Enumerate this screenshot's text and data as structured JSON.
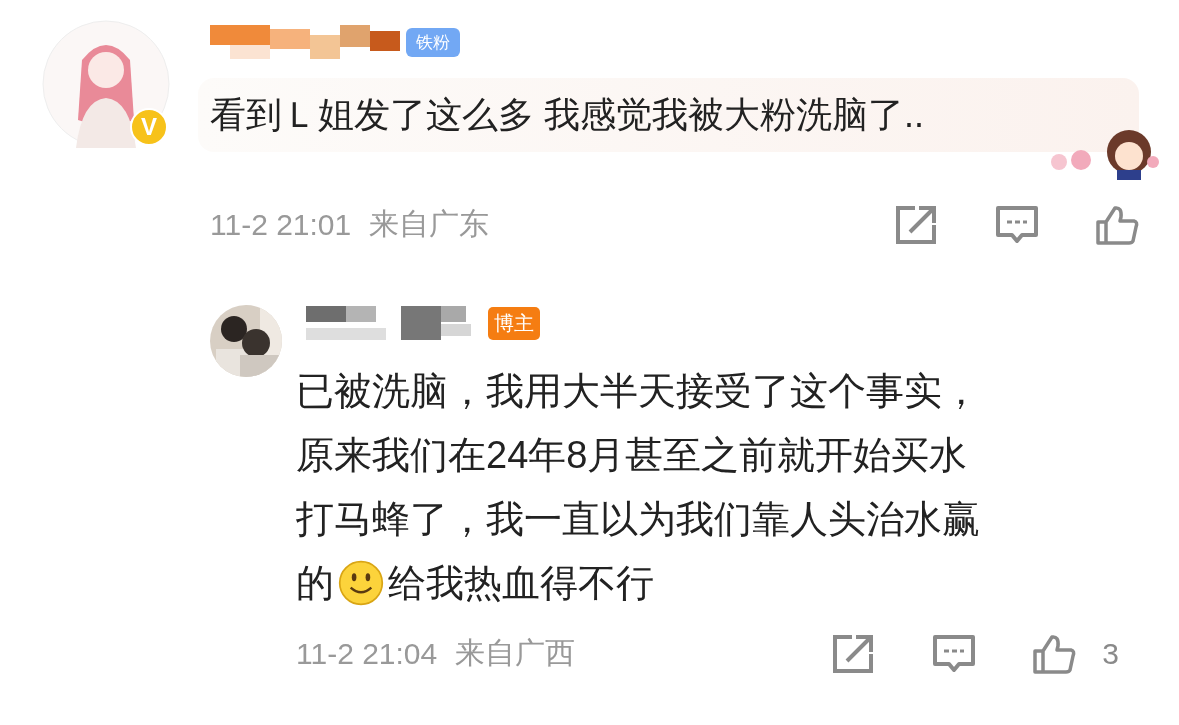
{
  "comment": {
    "badge": "铁粉",
    "verified_mark": "V",
    "text": "看到Ｌ姐发了这么多 我感觉我被大粉洗脑了..",
    "date": "11-2 21:01",
    "location": "来自广东"
  },
  "reply": {
    "badge": "博主",
    "lines": [
      "已被洗脑，我用大半天接受了这个事实，",
      "原来我们在24年8月甚至之前就开始买水",
      "打马蜂了，我一直以为我们靠人头治水赢"
    ],
    "last_line_before": "的",
    "last_line_after": "给我热血得不行",
    "date": "11-2 21:04",
    "location": "来自广西",
    "like_count": "3"
  }
}
